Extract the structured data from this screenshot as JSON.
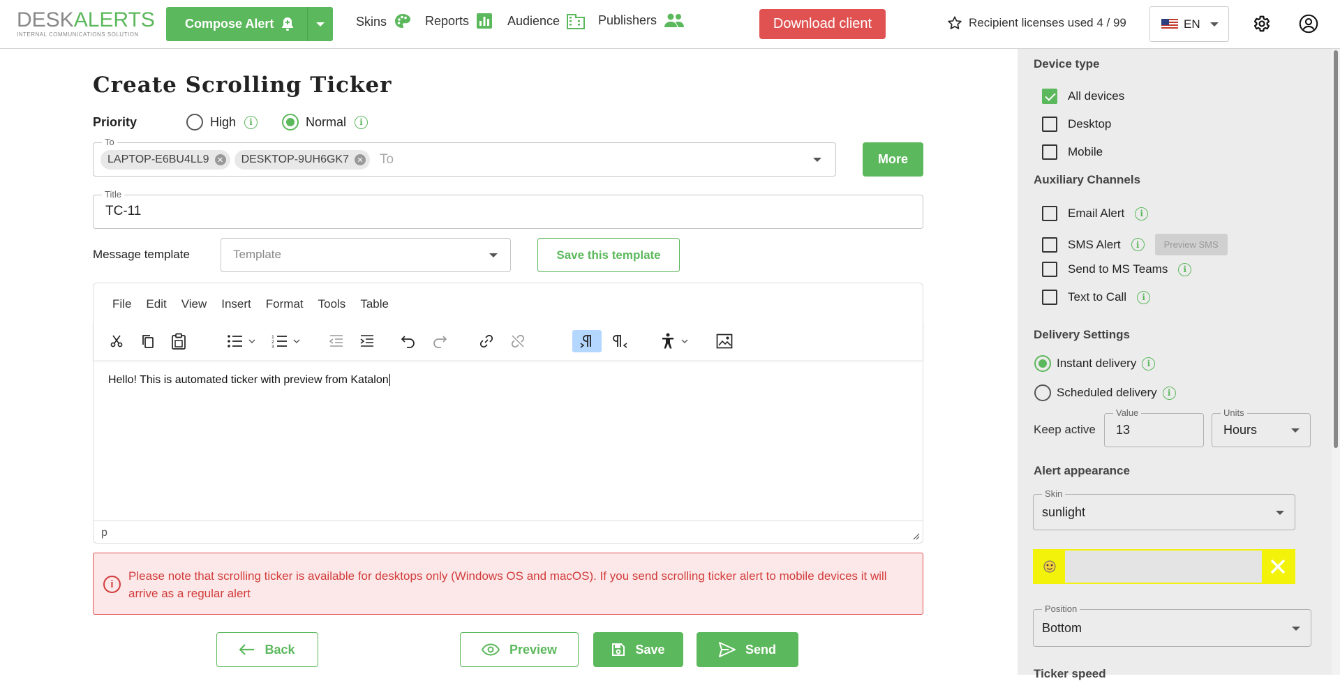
{
  "header": {
    "logo_desk": "DESK",
    "logo_alerts": "ALERTS",
    "logo_tagline": "INTERNAL COMMUNICATIONS SOLUTION",
    "compose_label": "Compose Alert",
    "nav": [
      {
        "label": "Skins",
        "icon": "palette-icon"
      },
      {
        "label": "Reports",
        "icon": "bar-chart-icon"
      },
      {
        "label": "Audience",
        "icon": "building-icon"
      },
      {
        "label": "Publishers",
        "icon": "people-icon"
      }
    ],
    "download_label": "Download client",
    "licenses_label": "Recipient licenses used 4 / 99",
    "language": "EN",
    "brand_color": "#5cb85c",
    "danger_color": "#e05252"
  },
  "form": {
    "title": "Create Scrolling Ticker",
    "priority_label": "Priority",
    "priority_high": "High",
    "priority_normal": "Normal",
    "priority_selected": "Normal",
    "to_label": "To",
    "to_placeholder": "To",
    "recipients": [
      "LAPTOP-E6BU4LL9",
      "DESKTOP-9UH6GK7"
    ],
    "more_label": "More",
    "title_label": "Title",
    "title_value": "TC-11",
    "template_label": "Message template",
    "template_placeholder": "Template",
    "save_template_label": "Save this template"
  },
  "editor": {
    "menu": [
      "File",
      "Edit",
      "View",
      "Insert",
      "Format",
      "Tools",
      "Table"
    ],
    "content": "Hello! This is automated ticker with preview from Katalon",
    "status_path": "p"
  },
  "notice": {
    "text": "Please note that scrolling ticker is available for desktops only (Windows OS and macOS). If you send scrolling ticker alert to mobile devices it will arrive as a regular alert"
  },
  "actions": {
    "back": "Back",
    "preview": "Preview",
    "save": "Save",
    "send": "Send"
  },
  "sidebar": {
    "device_type_title": "Device type",
    "devices": [
      {
        "label": "All devices",
        "checked": true
      },
      {
        "label": "Desktop",
        "checked": false
      },
      {
        "label": "Mobile",
        "checked": false
      }
    ],
    "aux_title": "Auxiliary Channels",
    "aux": [
      {
        "label": "Email Alert",
        "checked": false
      },
      {
        "label": "SMS Alert",
        "checked": false
      },
      {
        "label": "Send to MS Teams",
        "checked": false
      },
      {
        "label": "Text to Call",
        "checked": false
      }
    ],
    "preview_sms_label": "Preview SMS",
    "delivery_title": "Delivery Settings",
    "instant_label": "Instant delivery",
    "scheduled_label": "Scheduled delivery",
    "delivery_selected": "Instant delivery",
    "keep_active_label": "Keep active",
    "value_label": "Value",
    "value": "13",
    "units_label": "Units",
    "units": "Hours",
    "appearance_title": "Alert appearance",
    "skin_label": "Skin",
    "skin_value": "sunlight",
    "skin_preview_color": "#f2f20a",
    "position_label": "Position",
    "position_value": "Bottom",
    "ticker_speed_title": "Ticker speed"
  }
}
